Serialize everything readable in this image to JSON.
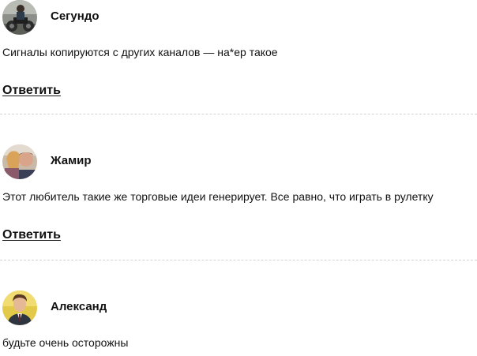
{
  "comments": [
    {
      "author": "Сегундо",
      "avatar": "avatar-photo-motorbike-icon",
      "text": "Сигналы копируются с других каналов — на*ер такое",
      "reply_label": "Ответить"
    },
    {
      "author": "Жамир",
      "avatar": "avatar-photo-couple-icon",
      "text": "Этот любитель такие же торговые идеи генерирует. Все равно, что играть в рулетку",
      "reply_label": "Ответить"
    },
    {
      "author": "Александ",
      "avatar": "avatar-photo-man-icon",
      "text": "будьте очень осторожны",
      "reply_label": ""
    }
  ],
  "colors": {
    "text": "#111111",
    "divider": "#d2d2d2",
    "background": "#ffffff"
  }
}
